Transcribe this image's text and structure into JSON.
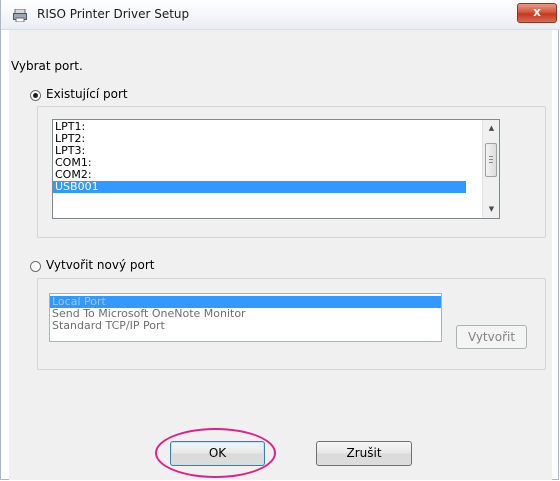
{
  "window": {
    "title": "RISO Printer Driver Setup",
    "close_label": "x"
  },
  "dialog": {
    "instruction": "Vybrat port.",
    "existing_port_label": "Existující port",
    "existing_ports": [
      "LPT1:",
      "LPT2:",
      "LPT3:",
      "COM1:",
      "COM2:",
      "USB001"
    ],
    "new_port_label": "Vytvořit nový port",
    "new_port_types": [
      "Local Port",
      "Send To Microsoft OneNote Monitor",
      "Standard TCP/IP Port"
    ],
    "create_button": "Vytvořit",
    "ok_button": "OK",
    "cancel_button": "Zrušit"
  },
  "colors": {
    "selection": "#3399ff",
    "highlight": "#e0208a",
    "close": "#c43a1e"
  },
  "icons": {
    "app": "printer-driver-icon",
    "close": "close-icon",
    "scroll_up": "scroll-up-arrow",
    "scroll_down": "scroll-down-arrow"
  }
}
